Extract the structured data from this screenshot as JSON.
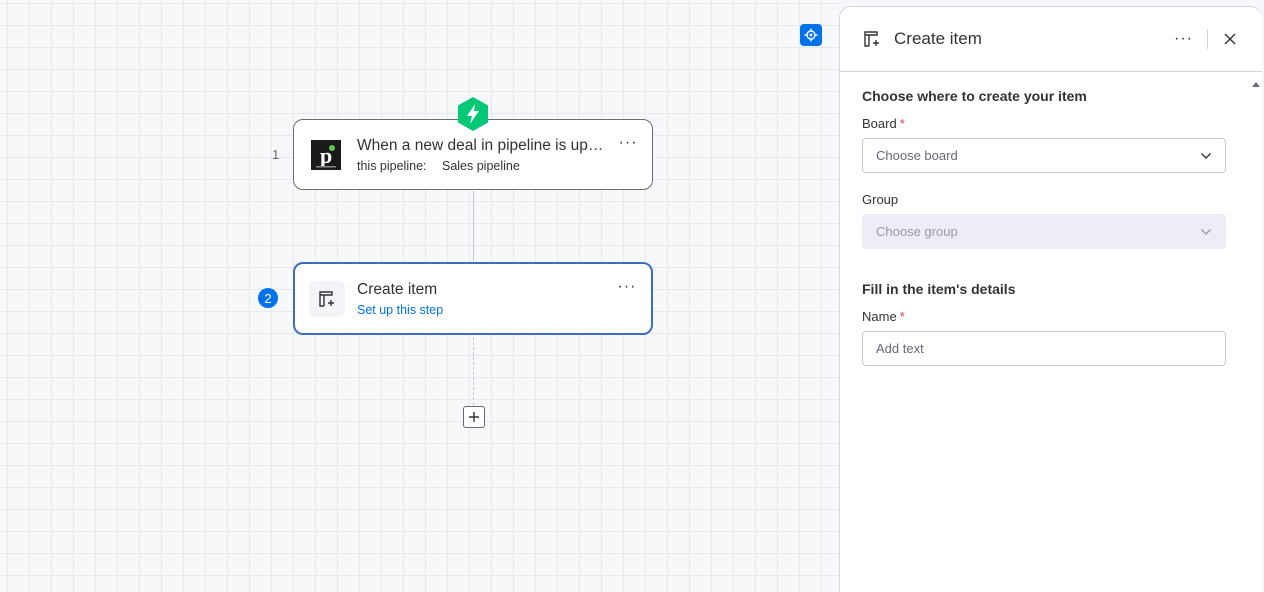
{
  "canvas": {
    "steps": [
      {
        "number": "1",
        "title": "When a new deal in pipeline is up…",
        "sub_label": "this pipeline:",
        "sub_value": "Sales pipeline",
        "app_icon": "pipedrive-logo",
        "more": "···"
      },
      {
        "number": "2",
        "title": "Create item",
        "sub_link": "Set up this step",
        "app_icon": "create-item-icon",
        "more": "···"
      }
    ],
    "trigger_badge_icon": "lightning-bolt-icon",
    "add_step_icon": "plus-icon",
    "recenter_icon": "recenter-icon"
  },
  "panel": {
    "title": "Create item",
    "more": "···",
    "sections": {
      "where": {
        "title": "Choose where to create your item",
        "board_label": "Board",
        "board_required": "*",
        "board_placeholder": "Choose board",
        "group_label": "Group",
        "group_placeholder": "Choose group"
      },
      "details": {
        "title": "Fill in the item's details",
        "name_label": "Name",
        "name_required": "*",
        "name_placeholder": "Add text"
      }
    }
  },
  "colors": {
    "accent": "#0073ea",
    "trigger_green": "#00c875",
    "required": "#d83a52"
  }
}
